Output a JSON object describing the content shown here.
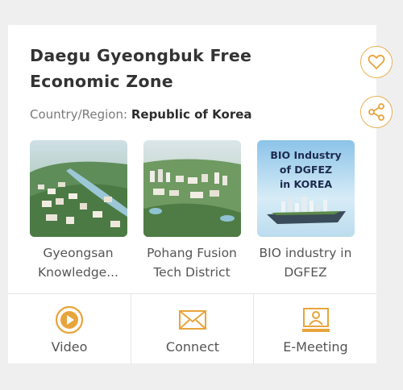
{
  "zone": {
    "title": "Daegu Gyeongbuk Free Economic Zone",
    "country_label": "Country/Region:",
    "country_value": "Republic of Korea"
  },
  "districts": [
    {
      "label": "Gyeongsan Knowledge..."
    },
    {
      "label": "Pohang Fusion Tech District"
    },
    {
      "label": "BIO industry in DGFEZ",
      "image_text": "BIO Industry of DGFEZ in KOREA"
    }
  ],
  "actions": {
    "video": "Video",
    "connect": "Connect",
    "emeeting": "E-Meeting"
  },
  "icons": {
    "favorite": "heart-icon",
    "share": "share-icon",
    "video": "play-circle-icon",
    "connect": "envelope-icon",
    "emeeting": "video-person-icon"
  },
  "colors": {
    "accent": "#e8a43c",
    "title": "#333333",
    "muted": "#7a7a7a",
    "background": "#efefef",
    "card": "#ffffff"
  }
}
